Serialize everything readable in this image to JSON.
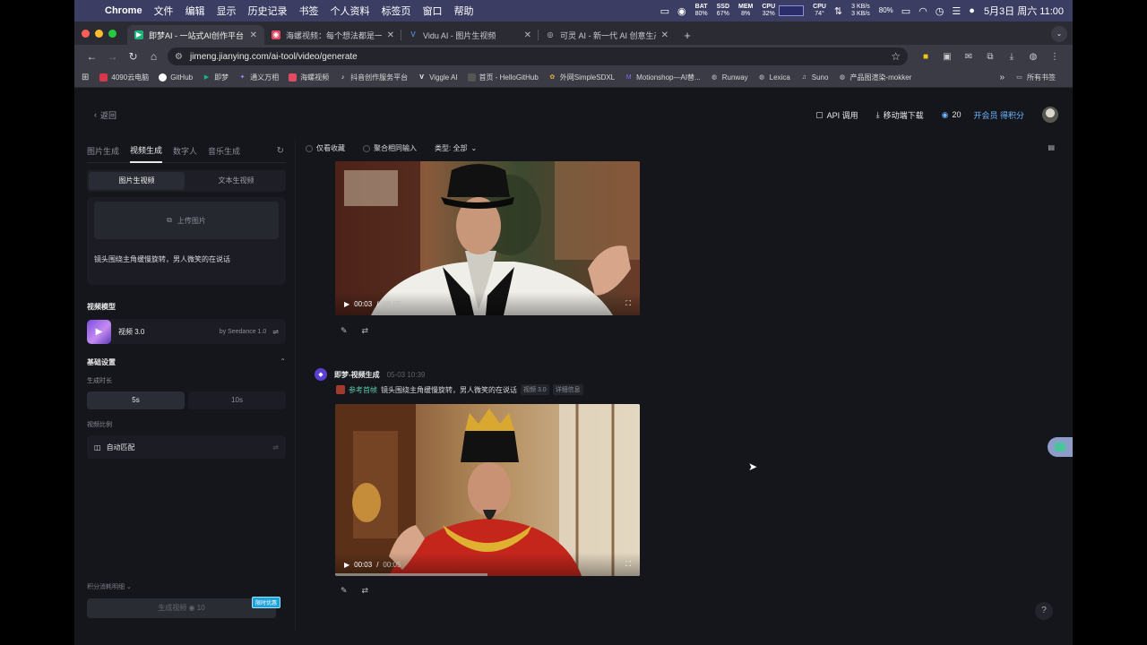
{
  "menubar": {
    "app": "Chrome",
    "items": [
      "文件",
      "编辑",
      "显示",
      "历史记录",
      "书签",
      "个人资料",
      "标签页",
      "窗口",
      "帮助"
    ],
    "stats": [
      {
        "label": "BAT",
        "value": "80%"
      },
      {
        "label": "SSD",
        "value": "67%"
      },
      {
        "label": "MEM",
        "value": "8%"
      },
      {
        "label": "CPU",
        "value": "32%"
      }
    ],
    "cpu_temp": {
      "label": "CPU",
      "value": "74°"
    },
    "net": {
      "up": "3 KB/s",
      "down": "3 KB/s"
    },
    "battery": "80%",
    "clock": "5月3日 周六  11:00"
  },
  "tabs": [
    {
      "title": "即梦AI - 一站式AI创作平台",
      "active": true,
      "color": "#1fb37a",
      "glyph": "▶"
    },
    {
      "title": "海螺视频：每个想法都是一部大片",
      "active": false,
      "color": "#e14a63",
      "glyph": "◉"
    },
    {
      "title": "Vidu AI - 图片生视频",
      "active": false,
      "color": "#2b7cf0",
      "glyph": "V"
    },
    {
      "title": "可灵 AI - 新一代 AI 创意生产力平台",
      "active": false,
      "color": "#666",
      "glyph": "◎"
    }
  ],
  "address": {
    "url": "jimeng.jianying.com/ai-tool/video/generate"
  },
  "bookmarks": [
    {
      "label": "4090云电脑",
      "color": "#d8374a"
    },
    {
      "label": "GitHub",
      "color": "#fff"
    },
    {
      "label": "即梦",
      "color": "#1fb37a"
    },
    {
      "label": "通义万相",
      "color": "#7a5cf0"
    },
    {
      "label": "海螺视频",
      "color": "#e14a63"
    },
    {
      "label": "抖音创作服务平台",
      "color": "#111"
    },
    {
      "label": "Viggle AI",
      "color": "#fff"
    },
    {
      "label": "首页 - HelloGitHub",
      "color": "#444"
    },
    {
      "label": "外网SimpleSDXL",
      "color": "#e2b43d"
    },
    {
      "label": "Motionshop—AI替...",
      "color": "#8a6cf0"
    },
    {
      "label": "Runway",
      "color": "#ccc"
    },
    {
      "label": "Lexica",
      "color": "#ccc"
    },
    {
      "label": "Suno",
      "color": "#ccc"
    },
    {
      "label": "产品图渲染-mokker",
      "color": "#ccc"
    }
  ],
  "bookmarks_folder": "所有书签",
  "topnav": {
    "back": "返回",
    "api": "API 调用",
    "mobile": "移动端下载",
    "points": "20",
    "vip": "开会员 得积分"
  },
  "sidebar": {
    "tabs": [
      "图片生成",
      "视频生成",
      "数字人",
      "音乐生成"
    ],
    "active_tab": "视频生成",
    "subtabs": [
      "图片生视频",
      "文本生视频"
    ],
    "upload_label": "上传图片",
    "prompt": "镜头围绕主角缓慢旋转，男人微笑的在说话",
    "model_section": "视频模型",
    "model_name": "视频 3.0",
    "model_by": "by Seedance 1.0",
    "basic_section": "基础设置",
    "duration_label": "生成时长",
    "durations": [
      "5s",
      "10s"
    ],
    "ratio_label": "视频比例",
    "ratio_value": "自动匹配",
    "credits_label": "积分消耗明细",
    "generate_label": "生成视频",
    "generate_cost": "10",
    "promo_badge": "限时优惠"
  },
  "feed": {
    "filters": [
      "仅看收藏",
      "聚合相同输入",
      "类型: 全部"
    ],
    "video1": {
      "time": "00:03",
      "duration": "00:05"
    },
    "entry": {
      "name": "即梦-视频生成",
      "time": "05-03  10:39",
      "ref": "参考首帧",
      "prompt": "镜头围绕主角缓慢旋转，男人微笑的在说话",
      "model_tag": "视频 3.0",
      "detail_tag": "详细信息"
    },
    "video2": {
      "time": "00:03",
      "duration": "00:05"
    }
  }
}
